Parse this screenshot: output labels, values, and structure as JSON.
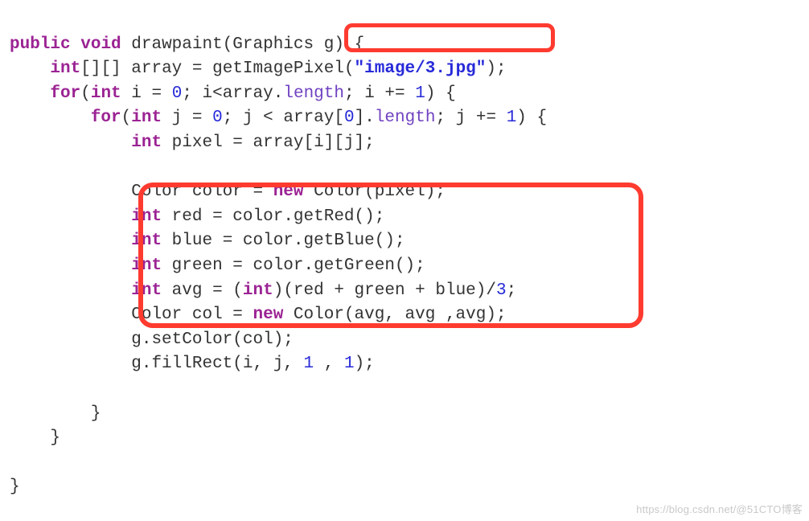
{
  "page": {
    "watermark": "https://blog.csdn.net/@51CTO博客"
  },
  "code": {
    "l1": {
      "kw_public": "public",
      "kw_void": "void",
      "name": "drawpaint",
      "lp": "(",
      "type_g": "Graphics",
      "arg_g": "g",
      "rp": ")",
      "lb": "{"
    },
    "l2": {
      "kw_int": "int",
      "br": "[][]",
      "id_array": "array",
      "eq": "=",
      "id_call": "getImagePixel",
      "lp": "(",
      "str": "\"image/3.jpg\"",
      "rp": ")",
      "semi": ";"
    },
    "l3": {
      "kw_for": "for",
      "lp": "(",
      "kw_int": "int",
      "id_i": "i",
      "eq": "=",
      "n0": "0",
      "semi1": ";",
      "cond_a": "i<",
      "id_arr": "array",
      "dot": ".",
      "length": "length",
      "semi2": ";",
      "inc_a": "i +=",
      "n1": "1",
      "rp": ")",
      "lb": "{"
    },
    "l4": {
      "kw_for": "for",
      "lp": "(",
      "kw_int": "int",
      "id_j": "j",
      "eq": "=",
      "n0": "0",
      "semi1": ";",
      "cond_a": "j <",
      "id_arr": "array",
      "idx": "[",
      "nz": "0",
      "idx2": "]",
      "dot": ".",
      "length": "length",
      "semi2": ";",
      "inc_a": "j +=",
      "n1": "1",
      "rp": ")",
      "lb": "{"
    },
    "l5": {
      "kw_int": "int",
      "id_pixel": "pixel",
      "eq": "=",
      "id_arr": "array",
      "sub": "[i][j]",
      "semi": ";"
    },
    "l7": {
      "ty_color": "Color",
      "id_color": "color",
      "eq": "=",
      "kw_new": "new",
      "ty_ctor": "Color",
      "args": "(pixel);"
    },
    "l8": {
      "kw_int": "int",
      "id_red": "red",
      "eq": "=",
      "id_c": "color",
      "dot": ".",
      "mth": "getRed",
      "call": "();"
    },
    "l9": {
      "kw_int": "int",
      "id_blue": "blue",
      "eq": "=",
      "id_c": "color",
      "dot": ".",
      "mth": "getBlue",
      "call": "();"
    },
    "l10": {
      "kw_int": "int",
      "id_green": "green",
      "eq": "=",
      "id_c": "color",
      "dot": ".",
      "mth": "getGreen",
      "call": "();"
    },
    "l11": {
      "kw_int1": "int",
      "id_avg": "avg",
      "eq": "=",
      "lp": "(",
      "kw_int2": "int",
      "rp": ")",
      "expr": "(red + green + blue)/",
      "n3": "3",
      "semi": ";"
    },
    "l12": {
      "ty_color": "Color",
      "id_col": "col",
      "eq": "=",
      "kw_new": "new",
      "ty_ctor": "Color",
      "args": "(avg, avg ,avg);"
    },
    "l13": {
      "id_g": "g",
      "dot": ".",
      "mth": "setColor",
      "args": "(col);"
    },
    "l14": {
      "id_g": "g",
      "dot": ".",
      "mth": "fillRect",
      "a1": "(i, j,",
      "n1a": "1",
      "c": ",",
      "n1b": "1",
      "rp": ");"
    },
    "l16": {
      "rb": "}"
    },
    "l17": {
      "rb": "}"
    },
    "l19": {
      "rb": "}"
    }
  }
}
